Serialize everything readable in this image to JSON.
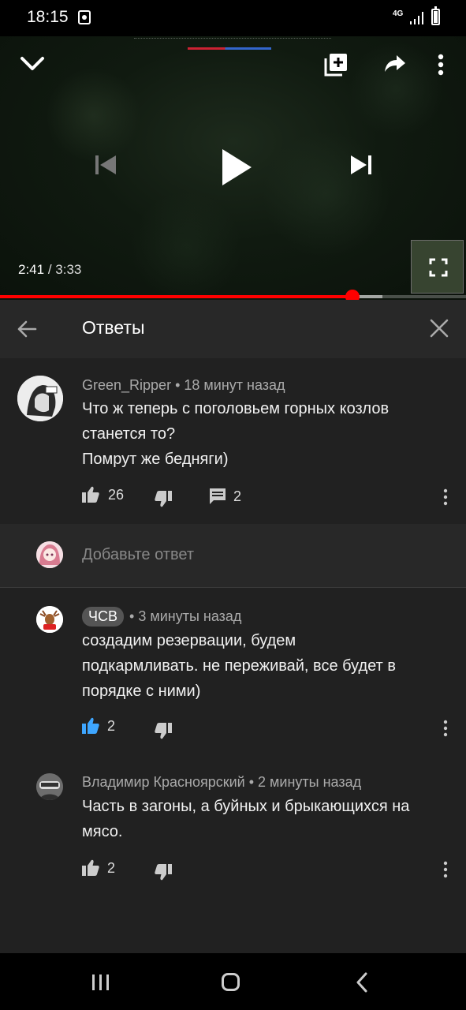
{
  "status_bar": {
    "time": "18:15",
    "network": "4G"
  },
  "video": {
    "current_time": "2:41",
    "separator": " / ",
    "duration": "3:33",
    "progress_fraction": 0.757
  },
  "replies_panel": {
    "title": "Ответы"
  },
  "parent_comment": {
    "author": "Green_Ripper",
    "time": "18 минут назад",
    "text_lines": [
      "Что ж теперь с поголовьем горных козлов",
      "станется то?",
      "Помрут же бедняги)"
    ],
    "likes": "26",
    "replies_count": "2"
  },
  "add_reply": {
    "placeholder": "Добавьте ответ"
  },
  "replies": [
    {
      "author": "ЧСВ",
      "author_is_badge": true,
      "time": "3 минуты назад",
      "text_lines": [
        "создадим резервации, будем",
        "подкармливать. не переживай, все будет в",
        "порядке с ними)"
      ],
      "likes": "2",
      "liked": true
    },
    {
      "author": "Владимир Красноярский",
      "author_is_badge": false,
      "time": "2 минуты назад",
      "text_lines": [
        "Часть в загоны, а буйных и брыкающихся на",
        "мясо."
      ],
      "likes": "2",
      "liked": false
    }
  ],
  "meta_separator": " • ",
  "colors": {
    "accent_red": "#ff0000",
    "like_active_blue": "#3ea6ff",
    "panel_bg": "#212121",
    "header_bg": "#282828"
  }
}
